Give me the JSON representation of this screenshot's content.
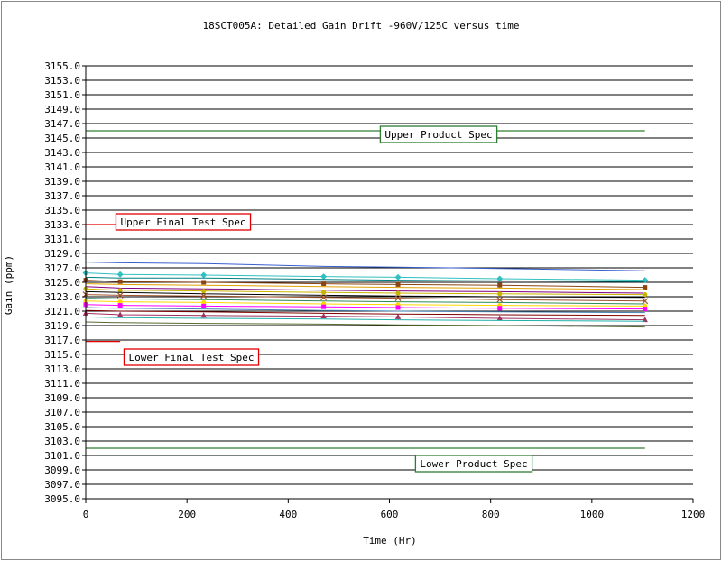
{
  "chart_data": {
    "type": "line",
    "title": "18SCT005A: Detailed Gain Drift -960V/125C versus time",
    "xlabel": "Time (Hr)",
    "ylabel": "Gain (ppm)",
    "xlim": [
      0,
      1200
    ],
    "ylim": [
      3095,
      3155
    ],
    "x_ticks": [
      0,
      200,
      400,
      600,
      800,
      1000,
      1200
    ],
    "x_tick_labels": [
      "0",
      "200",
      "400",
      "600",
      "800",
      "1000",
      "1200"
    ],
    "y_ticks": [
      3095,
      3097,
      3099,
      3101,
      3103,
      3105,
      3107,
      3109,
      3111,
      3113,
      3115,
      3117,
      3119,
      3121,
      3123,
      3125,
      3127,
      3129,
      3131,
      3133,
      3135,
      3137,
      3139,
      3141,
      3143,
      3145,
      3147,
      3149,
      3151,
      3153,
      3155
    ],
    "y_tick_labels": [
      "3095.0",
      "3097.0",
      "3099.0",
      "3101.0",
      "3103.0",
      "3105.0",
      "3107.0",
      "3109.0",
      "3111.0",
      "3113.0",
      "3115.0",
      "3117.0",
      "3119.0",
      "3121.0",
      "3123.0",
      "3125.0",
      "3127.0",
      "3129.0",
      "3131.0",
      "3133.0",
      "3135.0",
      "3137.0",
      "3139.0",
      "3141.0",
      "3143.0",
      "3145.0",
      "3147.0",
      "3149.0",
      "3151.0",
      "3153.0",
      "3155.0"
    ],
    "grid": true,
    "spec_lines": [
      {
        "label": "Upper Product Spec",
        "y": 3146,
        "x": [
          0,
          1105
        ],
        "color": "#2e7d32"
      },
      {
        "label": "Lower Product Spec",
        "y": 3102,
        "x": [
          0,
          1105
        ],
        "color": "#2e7d32"
      },
      {
        "label": "Upper Final Test Spec",
        "y": 3133,
        "x": [
          0,
          68
        ],
        "color": "#e00000"
      },
      {
        "label": "Lower Final Test Spec",
        "y": 3116.8,
        "x": [
          0,
          68
        ],
        "color": "#e00000"
      }
    ],
    "x": [
      0,
      68,
      233,
      470,
      617,
      818,
      1105
    ],
    "series": [
      {
        "color": "#3a5fcd",
        "marker": "none",
        "values": [
          3127.8,
          3127.7,
          3127.6,
          3127.2,
          3127.1,
          3126.9,
          3126.6
        ]
      },
      {
        "color": "#30c0c0",
        "marker": "diamond",
        "values": [
          3126.3,
          3126.1,
          3126.0,
          3125.8,
          3125.7,
          3125.5,
          3125.3
        ]
      },
      {
        "color": "#008080",
        "marker": "none",
        "values": [
          3125.7,
          3125.6,
          3125.6,
          3125.4,
          3125.3,
          3125.2,
          3125.1
        ]
      },
      {
        "color": "#8b4513",
        "marker": "square",
        "values": [
          3125.3,
          3125.1,
          3125.0,
          3124.8,
          3124.7,
          3124.6,
          3124.3
        ]
      },
      {
        "color": "#e0a000",
        "marker": "none",
        "values": [
          3124.8,
          3124.7,
          3124.6,
          3124.4,
          3124.3,
          3124.2,
          3124.0
        ]
      },
      {
        "color": "#800080",
        "marker": "none",
        "values": [
          3124.4,
          3124.2,
          3124.1,
          3123.9,
          3123.8,
          3123.7,
          3123.5
        ]
      },
      {
        "color": "#c8b400",
        "marker": "circle",
        "values": [
          3124.1,
          3123.9,
          3123.8,
          3123.6,
          3123.5,
          3123.4,
          3123.3
        ]
      },
      {
        "color": "#000000",
        "marker": "none",
        "values": [
          3123.7,
          3123.6,
          3123.4,
          3123.2,
          3123.1,
          3123.0,
          3122.9
        ]
      },
      {
        "color": "#a0522d",
        "marker": "star",
        "values": [
          3123.3,
          3123.2,
          3123.1,
          3122.9,
          3122.8,
          3122.6,
          3122.4
        ]
      },
      {
        "color": "#2e8b57",
        "marker": "none",
        "values": [
          3122.8,
          3122.7,
          3122.6,
          3122.4,
          3122.3,
          3122.2,
          3122.0
        ]
      },
      {
        "color": "#ffd700",
        "marker": "circle",
        "values": [
          3122.4,
          3122.3,
          3122.2,
          3122.0,
          3121.9,
          3121.8,
          3121.7
        ]
      },
      {
        "color": "#ff00ff",
        "marker": "square",
        "values": [
          3121.9,
          3121.8,
          3121.7,
          3121.6,
          3121.5,
          3121.4,
          3121.3
        ]
      },
      {
        "color": "#4682b4",
        "marker": "none",
        "values": [
          3121.5,
          3121.4,
          3121.3,
          3121.1,
          3121.0,
          3120.9,
          3120.8
        ]
      },
      {
        "color": "#800000",
        "marker": "none",
        "values": [
          3121.1,
          3121.0,
          3120.9,
          3120.7,
          3120.6,
          3120.5,
          3120.4
        ]
      },
      {
        "color": "#a03060",
        "marker": "triangle",
        "values": [
          3120.7,
          3120.5,
          3120.4,
          3120.3,
          3120.2,
          3120.0,
          3119.8
        ]
      },
      {
        "color": "#20b2aa",
        "marker": "none",
        "values": [
          3120.2,
          3120.1,
          3120.0,
          3119.9,
          3119.8,
          3119.7,
          3119.6
        ]
      },
      {
        "color": "#556b2f",
        "marker": "none",
        "values": [
          3119.5,
          3119.4,
          3119.3,
          3119.2,
          3119.1,
          3119.0,
          3118.8
        ]
      }
    ]
  }
}
